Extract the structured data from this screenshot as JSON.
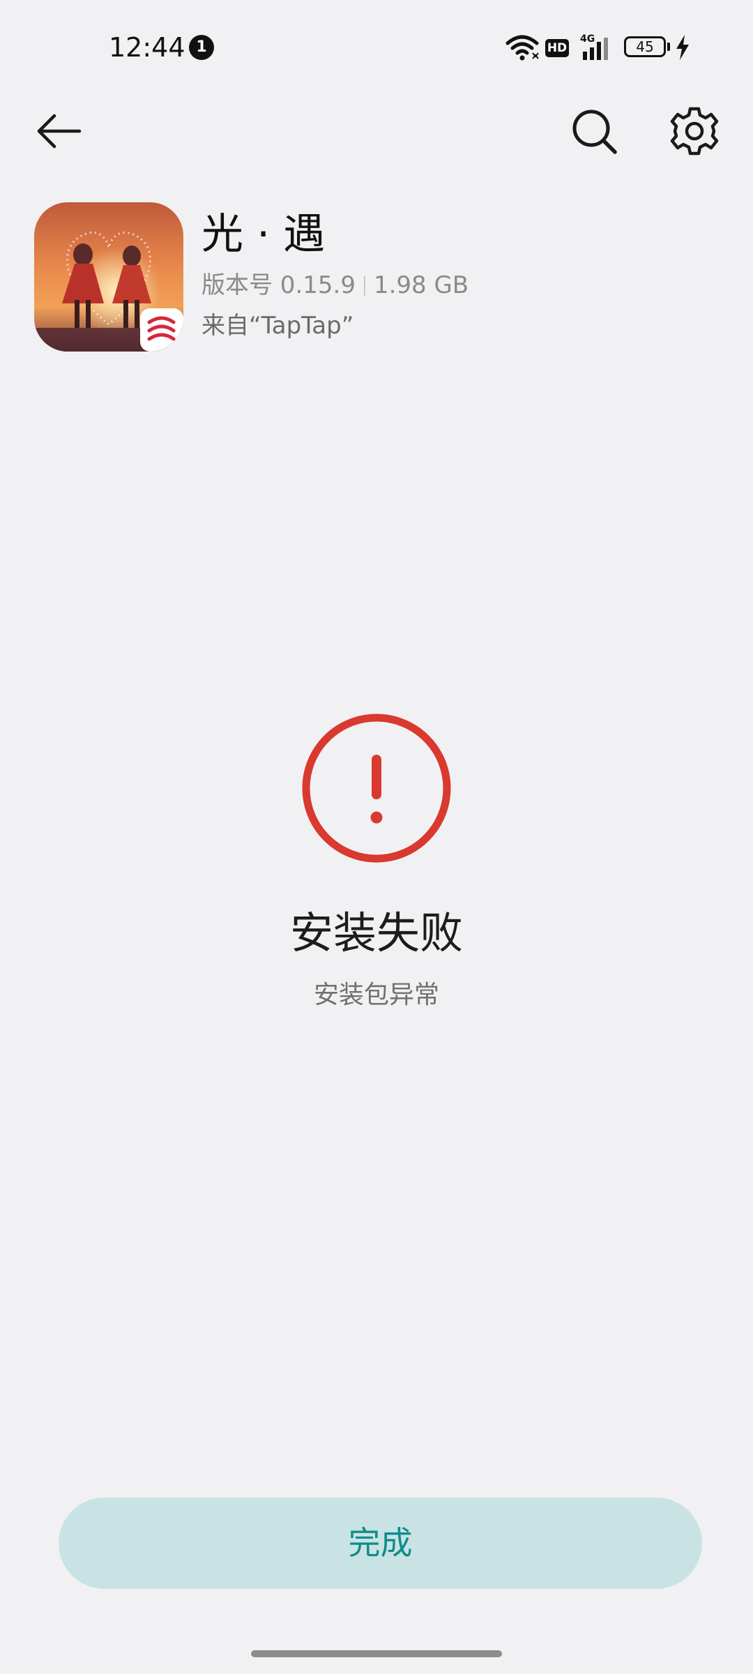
{
  "status_bar": {
    "time": "12:44",
    "notification_count": "1",
    "hd_label": "HD",
    "network_label": "4G",
    "battery_level": "45"
  },
  "toolbar": {
    "back_icon": "back-arrow-icon",
    "search_icon": "search-icon",
    "settings_icon": "gear-icon"
  },
  "app": {
    "name": "光 · 遇",
    "version_label": "版本号 0.15.9",
    "size": "1.98 GB",
    "source": "来自“TapTap”",
    "publisher_badge_icon": "netease-logo-icon"
  },
  "result": {
    "icon": "exclamation-circle-icon",
    "title": "安装失败",
    "subtitle": "安装包异常",
    "accent_color": "#d9392e"
  },
  "actions": {
    "done_label": "完成"
  },
  "colors": {
    "background": "#f1f1f3",
    "button_bg": "#c9e3e4",
    "button_text": "#0f8c8c"
  }
}
